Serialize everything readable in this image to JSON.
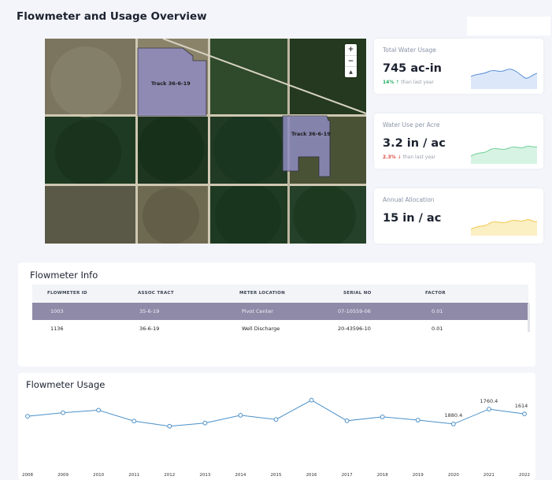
{
  "page": {
    "title": "Flowmeter and Usage Overview"
  },
  "map": {
    "labels": [
      "Track 36-6-19",
      "Track 36-6-19"
    ],
    "zoom_in": "+",
    "zoom_out": "−",
    "compass": "▲"
  },
  "cards": [
    {
      "label": "Total Water Usage",
      "value": "745 ac-in",
      "delta_pct": "14%",
      "delta_arrow": "↑",
      "delta_text": "than last year",
      "color": "#5b8fd9",
      "fill": "#dce8fa",
      "trend": "up"
    },
    {
      "label": "Water Use per Acre",
      "value": "3.2 in / ac",
      "delta_pct": "2.3%",
      "delta_arrow": "↓",
      "delta_text": "than last year",
      "color": "#6fcf97",
      "fill": "#d7f3e3",
      "trend": "down"
    },
    {
      "label": "Annual Allocation",
      "value": "15 in / ac",
      "color": "#f2c94c",
      "fill": "#fbefc4"
    }
  ],
  "flowmeter_info": {
    "title": "Flowmeter Info",
    "columns": [
      "FLOWMETER ID",
      "ASSOC TRACT",
      "METER LOCATION",
      "SERIAL NO",
      "FACTOR"
    ],
    "rows": [
      [
        "1003",
        "35-6-19",
        "Pivot Center",
        "07-10559-06",
        "0.01"
      ],
      [
        "1136",
        "36-6-19",
        "Well Discharge",
        "20-43596-10",
        "0.01"
      ]
    ]
  },
  "usage": {
    "title": "Flowmeter Usage",
    "point_labels": [
      {
        "year": "2020",
        "text": "1880.4"
      },
      {
        "year": "2021",
        "text": "1760.4"
      },
      {
        "year": "2022",
        "text": "1614"
      }
    ]
  },
  "chart_data": {
    "type": "line",
    "title": "Flowmeter Usage",
    "xlabel": "",
    "ylabel": "",
    "x": [
      "2008",
      "2009",
      "2010",
      "2011",
      "2012",
      "2013",
      "2014",
      "2015",
      "2016",
      "2017",
      "2018",
      "2019",
      "2020",
      "2021",
      "2022"
    ],
    "series": [
      {
        "values": [
          1540,
          1650,
          1730,
          1390,
          1230,
          1330,
          1570,
          1440,
          2040,
          1400,
          1520,
          1420,
          1300,
          1760.4,
          1614
        ]
      }
    ],
    "ylim": [
      0,
      2400
    ],
    "grid": false,
    "color": "#4a90c8"
  }
}
